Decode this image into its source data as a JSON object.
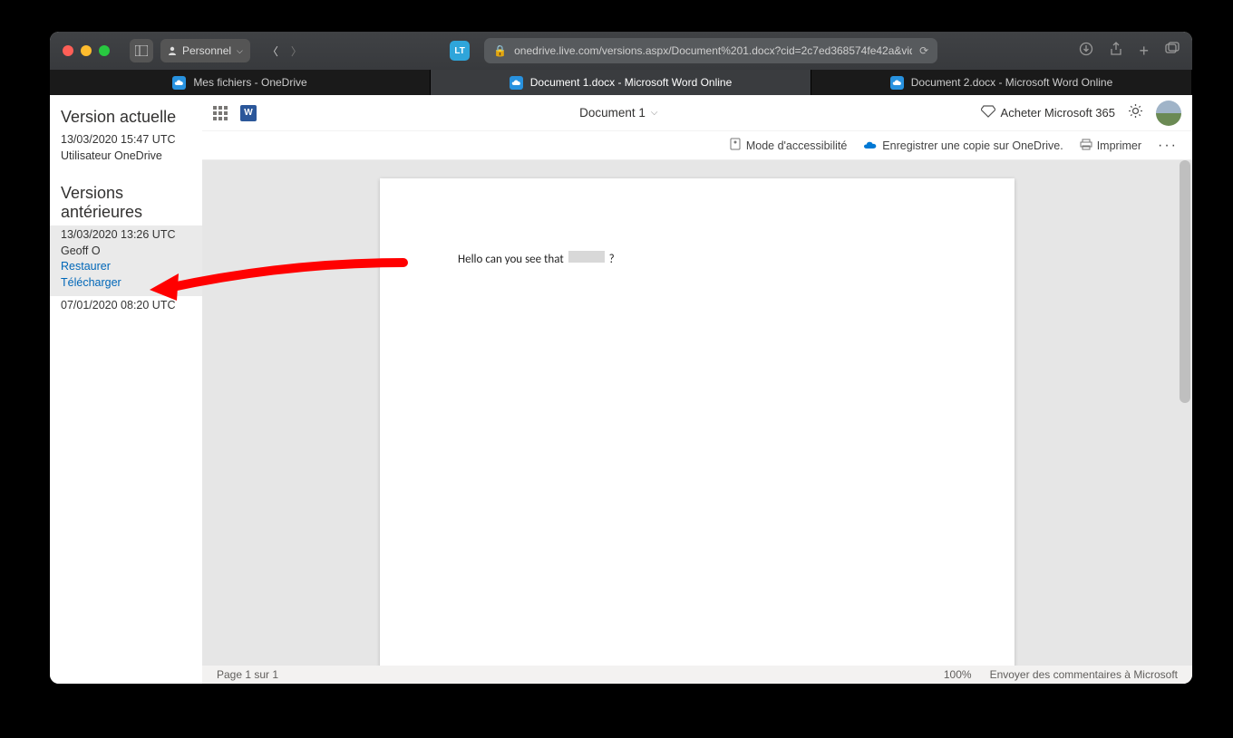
{
  "browser": {
    "profile_label": "Personnel",
    "url": "onedrive.live.com/versions.aspx/Document%201.docx?cid=2c7ed368574fe42a&vid",
    "tabs": [
      {
        "label": "Mes fichiers - OneDrive",
        "active": false
      },
      {
        "label": "Document 1.docx - Microsoft Word Online",
        "active": true
      },
      {
        "label": "Document 2.docx - Microsoft Word Online",
        "active": false
      }
    ]
  },
  "sidebar": {
    "current_heading": "Version actuelle",
    "current": {
      "time": "13/03/2020 15:47 UTC",
      "user": "Utilisateur OneDrive"
    },
    "older_heading": "Versions antérieures",
    "older": [
      {
        "time": "13/03/2020 13:26 UTC",
        "user": "Geoff O",
        "restore": "Restaurer",
        "download": "Télécharger",
        "selected": true
      },
      {
        "time": "07/01/2020 08:20 UTC"
      }
    ]
  },
  "header": {
    "doc_title": "Document 1",
    "premium": "Acheter Microsoft 365"
  },
  "commands": {
    "accessibility": "Mode d'accessibilité",
    "save_copy": "Enregistrer une copie sur OneDrive.",
    "print": "Imprimer"
  },
  "document": {
    "line_prefix": "Hello can you see that ",
    "line_suffix": " ?"
  },
  "status": {
    "page": "Page 1 sur 1",
    "zoom": "100%",
    "feedback": "Envoyer des commentaires à Microsoft"
  }
}
